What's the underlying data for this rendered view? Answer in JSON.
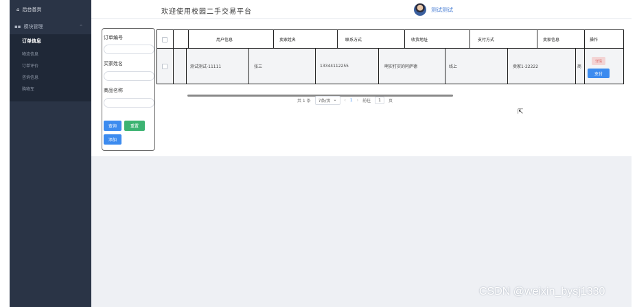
{
  "sidebar": {
    "home_label": "后台首页",
    "group_label": "模块管理",
    "items": [
      {
        "label": "订单信息",
        "active": true
      },
      {
        "label": "物流信息"
      },
      {
        "label": "订单评价"
      },
      {
        "label": "咨询信息"
      },
      {
        "label": "购物车"
      }
    ]
  },
  "header": {
    "title": "欢迎使用校园二手交易平台",
    "user_name": "测试测试"
  },
  "search": {
    "order_no_label": "订单编号",
    "buyer_label": "买家姓名",
    "product_label": "商品名称",
    "query_button": "查询",
    "reset_button": "重置",
    "add_button": "添加"
  },
  "table": {
    "columns": [
      "用户信息",
      "卖家姓名",
      "联系方式",
      "收货地址",
      "支付方式",
      "卖家信息",
      "操作"
    ],
    "rows": [
      {
        "user_info": "测试测试-11111",
        "seller_name": "张三",
        "contact": "13344112255",
        "address": "啊实打实的阿萨德",
        "payment": "线上",
        "seller_info": "卖家1-22222",
        "truncated": "商",
        "detail_button": "详情",
        "pay_button": "支付"
      }
    ]
  },
  "pagination": {
    "total": "共 1 条",
    "page_size": "7条/页",
    "current_page": "1",
    "goto_label": "前往",
    "goto_value": "1",
    "page_suffix": "页"
  },
  "watermark": "CSDN @weixin_bysj1330"
}
